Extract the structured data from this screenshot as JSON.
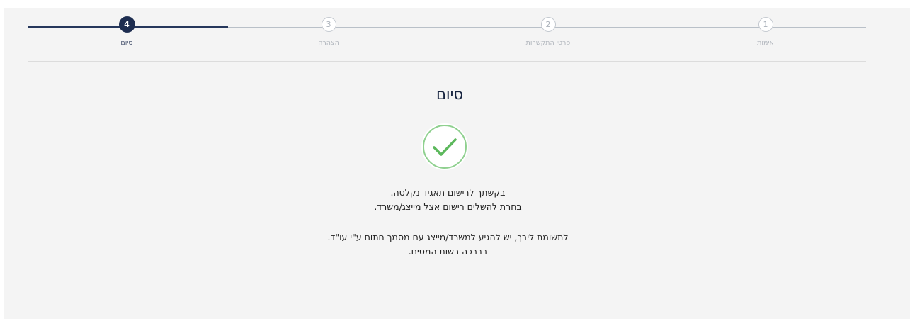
{
  "steps": [
    {
      "number": "1",
      "label": "אימות",
      "state": "pending"
    },
    {
      "number": "2",
      "label": "פרטי התקשרות",
      "state": "pending"
    },
    {
      "number": "3",
      "label": "הצהרה",
      "state": "pending"
    },
    {
      "number": "4",
      "label": "סיום",
      "state": "active"
    }
  ],
  "main": {
    "title": "סיום",
    "success_icon": "check-circle-icon",
    "lines": [
      "בקשתך לרישום תאגיד נקלטה.",
      "בחרת להשלים רישום אצל מייצג/משרד.",
      "לתשומת ליבך, יש להגיע למשרד/מייצג עם מסמך חתום ע\"י עו\"ד.",
      "בברכה רשות המסים."
    ]
  },
  "colors": {
    "accent": "#1d2d50",
    "success": "#5cb85c",
    "background": "#f4f4f4"
  }
}
